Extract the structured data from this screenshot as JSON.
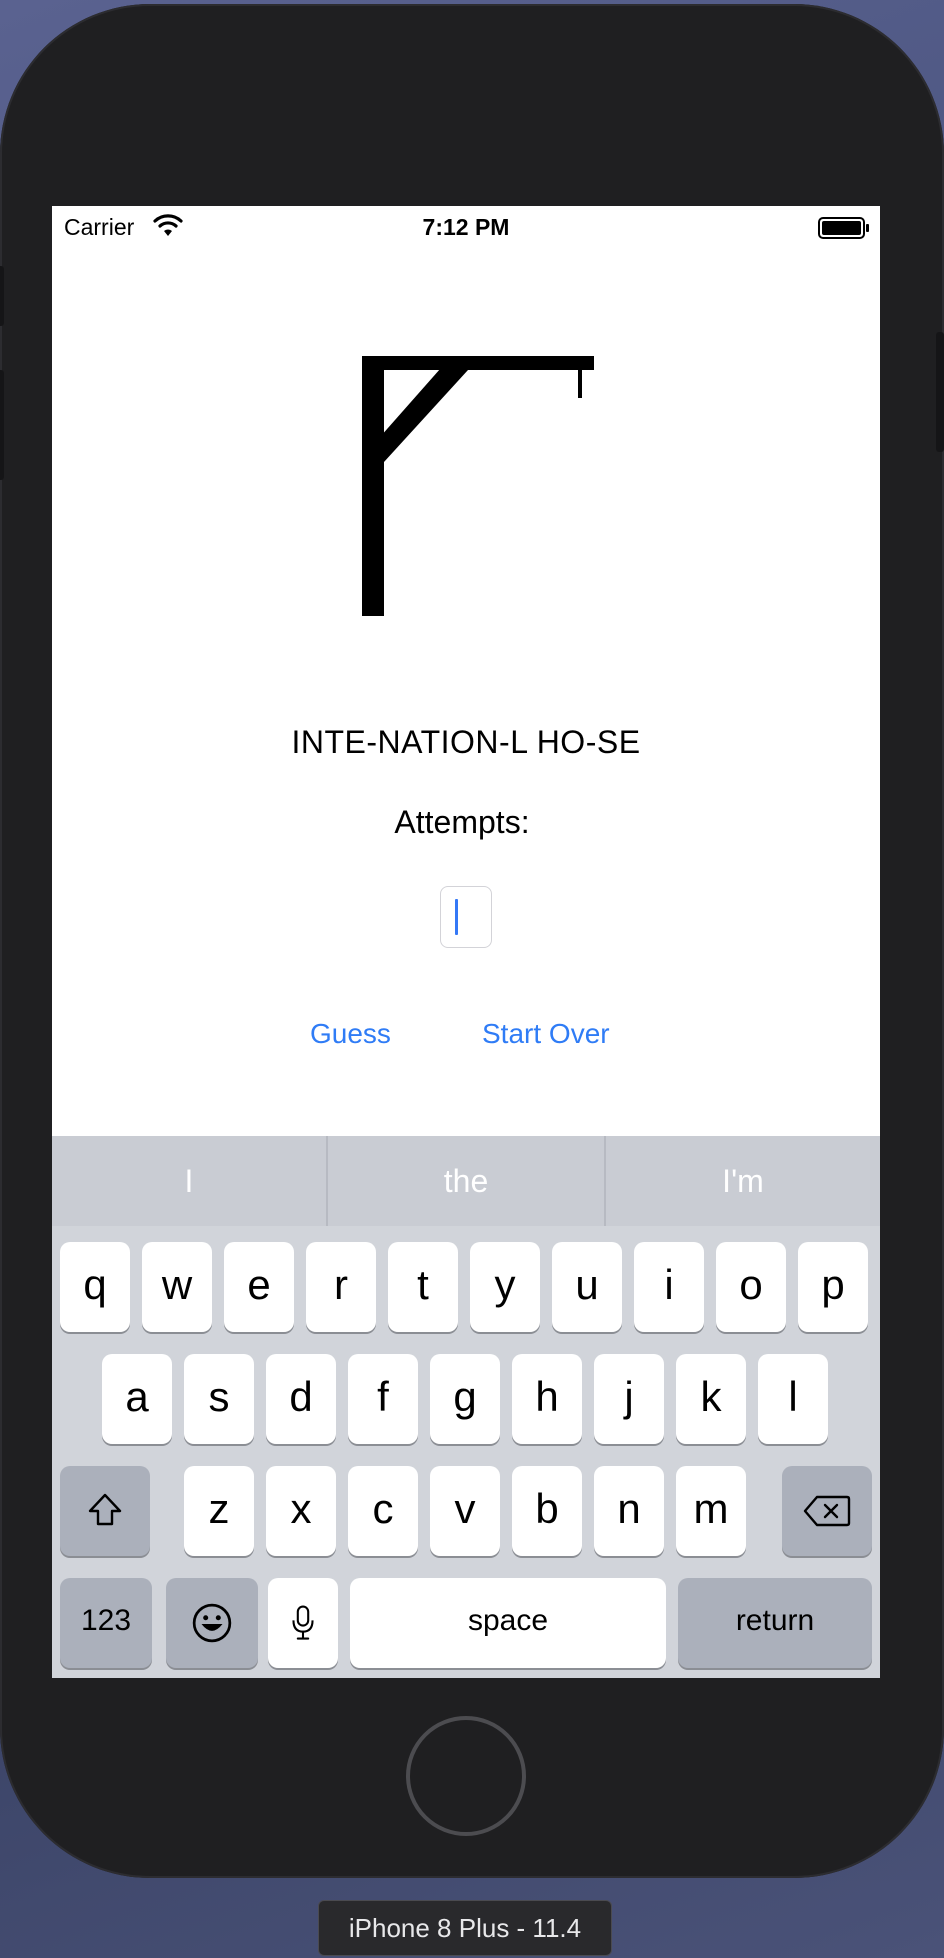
{
  "status_bar": {
    "carrier": "Carrier",
    "time": "7:12 PM"
  },
  "game": {
    "word": "INTE-NATION-L HO-SE",
    "attempts_label": "Attempts:",
    "guess_value": "",
    "guess_button": "Guess",
    "start_over_button": "Start Over"
  },
  "keyboard": {
    "suggestions": [
      "I",
      "the",
      "I'm"
    ],
    "row1": [
      "q",
      "w",
      "e",
      "r",
      "t",
      "y",
      "u",
      "i",
      "o",
      "p"
    ],
    "row2": [
      "a",
      "s",
      "d",
      "f",
      "g",
      "h",
      "j",
      "k",
      "l"
    ],
    "row3": [
      "z",
      "x",
      "c",
      "v",
      "b",
      "n",
      "m"
    ],
    "numbers_key": "123",
    "space_key": "space",
    "return_key": "return"
  },
  "simulator": {
    "device_label": "iPhone 8 Plus - 11.4"
  },
  "colors": {
    "accent": "#2f7cf6",
    "keyboard_bg": "#d1d4da"
  }
}
